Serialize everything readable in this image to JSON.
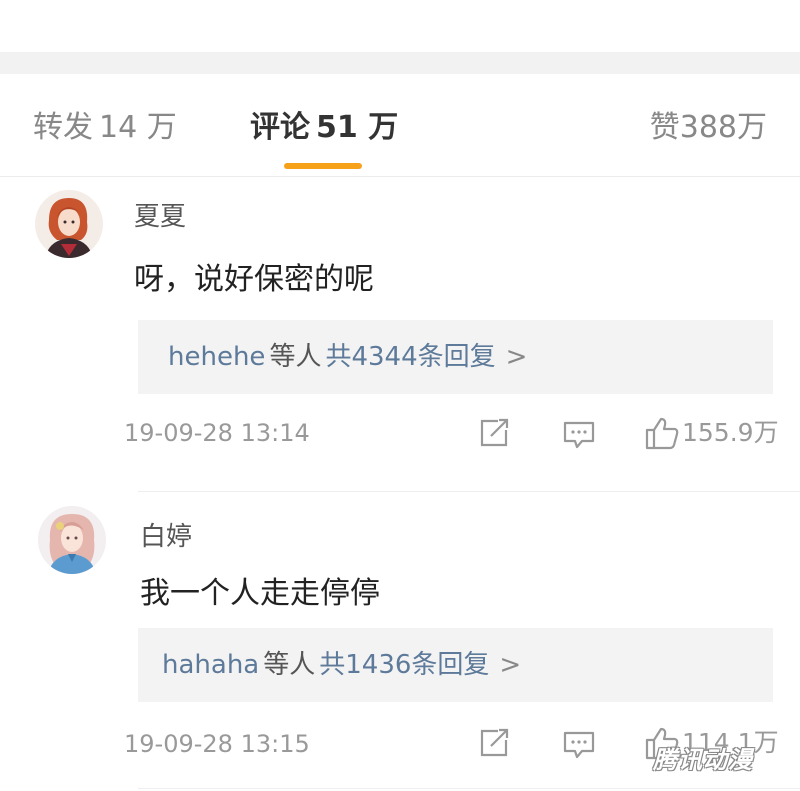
{
  "tabs": {
    "repost": {
      "label": "转发",
      "count": "14 万"
    },
    "comment": {
      "label": "评论",
      "count": "51 万"
    },
    "like": {
      "label": "赞",
      "count": "388万"
    }
  },
  "comments": [
    {
      "username": "夏夏",
      "text": "呀，说好保密的呢",
      "reply_user": "hehehe",
      "reply_others": "等人",
      "reply_total": "共4344条回复",
      "reply_chevron": ">",
      "time": "19-09-28  13:14",
      "likes": "155.9万"
    },
    {
      "username": "白婷",
      "text": "我一个人走走停停",
      "reply_user": "hahaha",
      "reply_others": "等人",
      "reply_total": "共1436条回复",
      "reply_chevron": ">",
      "time": "19-09-28  13:15",
      "likes": "114.1万"
    }
  ],
  "watermark": "腾讯动漫",
  "colors": {
    "accent_underline": "#f7a11a",
    "link_blue": "#5d7a9a",
    "meta_gray": "#999999",
    "reply_bg": "#f3f3f3"
  },
  "icons": [
    "share-icon",
    "comment-icon",
    "thumbs-up-icon"
  ]
}
